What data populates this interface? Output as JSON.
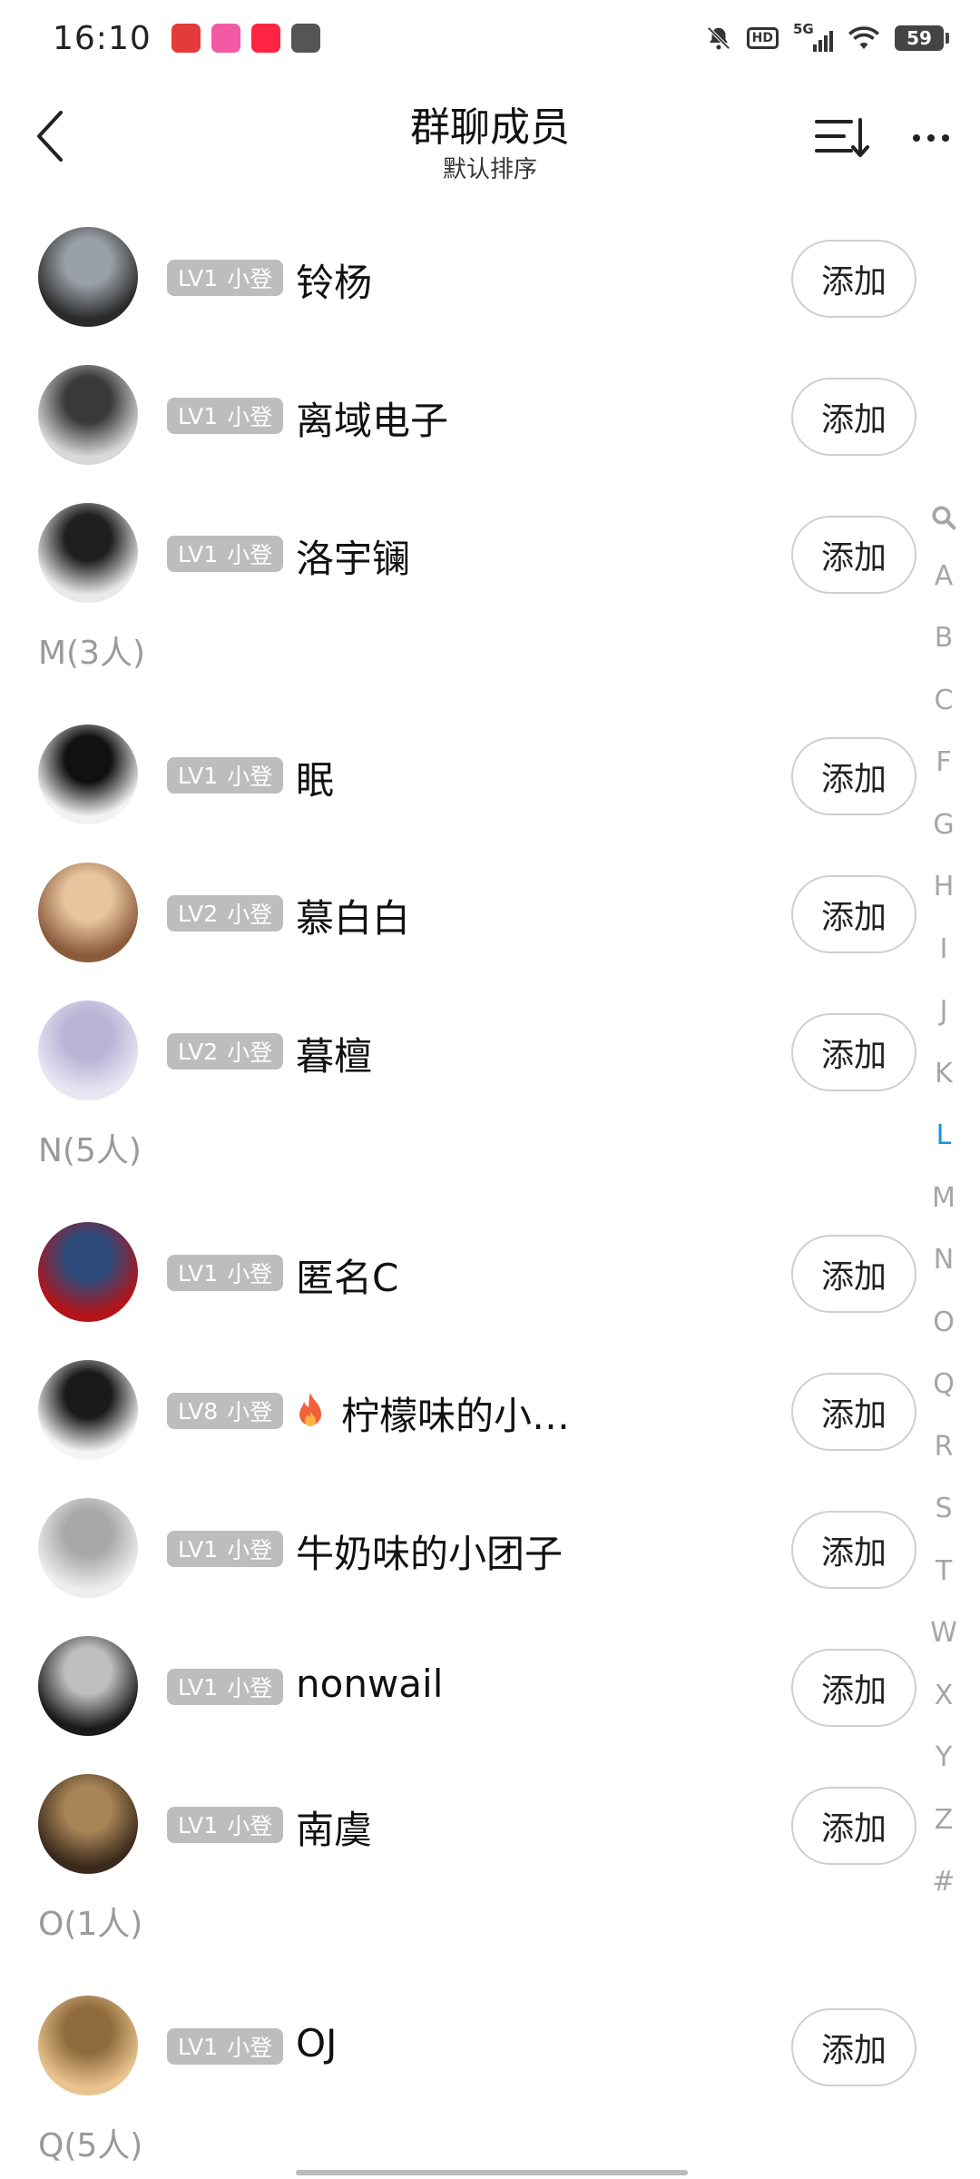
{
  "status_bar": {
    "time": "16:10",
    "network": "5G",
    "hd": "HD",
    "battery": "59",
    "notification_icons": [
      {
        "name": "clown-app-icon",
        "color": "#e33b3b"
      },
      {
        "name": "lofter-app-icon",
        "color": "#f25aa6"
      },
      {
        "name": "xiaohongshu-app-icon",
        "color": "#ff2442"
      },
      {
        "name": "mail-icon",
        "color": "#555555"
      }
    ]
  },
  "header": {
    "title": "群聊成员",
    "subtitle": "默认排序"
  },
  "level_suffix": "小登",
  "add_label": "添加",
  "sections": [
    {
      "header": "",
      "members": [
        {
          "level": "LV1",
          "name": "铃杨",
          "avatar_colors": [
            "#2a2a2a",
            "#9aa0a8"
          ]
        },
        {
          "level": "LV1",
          "name": "离域电子",
          "avatar_colors": [
            "#d9d9d9",
            "#3a3a3a"
          ]
        },
        {
          "level": "LV1",
          "name": "洛宇镧",
          "avatar_colors": [
            "#e9e9e9",
            "#1f1f1f"
          ]
        }
      ]
    },
    {
      "header": "M(3人)",
      "members": [
        {
          "level": "LV1",
          "name": "眠",
          "avatar_colors": [
            "#f2f2f2",
            "#111111"
          ]
        },
        {
          "level": "LV2",
          "name": "慕白白",
          "avatar_colors": [
            "#8b5a3c",
            "#e8c7a0"
          ]
        },
        {
          "level": "LV2",
          "name": "暮檀",
          "avatar_colors": [
            "#e8e6f3",
            "#b9b3d6"
          ]
        }
      ]
    },
    {
      "header": "N(5人)",
      "members": [
        {
          "level": "LV1",
          "name": "匿名C",
          "avatar_colors": [
            "#b3141a",
            "#2c4a7a"
          ]
        },
        {
          "level": "LV8",
          "name": "柠檬味的小…",
          "fire": true,
          "avatar_colors": [
            "#f4f4f4",
            "#1a1a1a"
          ]
        },
        {
          "level": "LV1",
          "name": "牛奶味的小团子",
          "avatar_colors": [
            "#eeeeee",
            "#a8a8a8"
          ]
        },
        {
          "level": "LV1",
          "name": "nonwail",
          "avatar_colors": [
            "#1b1b1b",
            "#bfbfbf"
          ]
        },
        {
          "level": "LV1",
          "name": "南虞",
          "avatar_colors": [
            "#3b2a1c",
            "#a88456"
          ]
        }
      ]
    },
    {
      "header": "O(1人)",
      "members": [
        {
          "level": "LV1",
          "name": "OJ",
          "avatar_colors": [
            "#e9c48f",
            "#8f6b3c"
          ]
        }
      ]
    },
    {
      "header": "Q(5人)",
      "members": []
    }
  ],
  "alpha_index": [
    "A",
    "B",
    "C",
    "F",
    "G",
    "H",
    "I",
    "J",
    "K",
    "L",
    "M",
    "N",
    "O",
    "Q",
    "R",
    "S",
    "T",
    "W",
    "X",
    "Y",
    "Z",
    "#"
  ],
  "alpha_active": "L",
  "colors": {
    "accent": "#1296db",
    "badge_bg": "#bdbdbd",
    "section_text": "#9a9a9a",
    "fire": "#f0603a"
  }
}
